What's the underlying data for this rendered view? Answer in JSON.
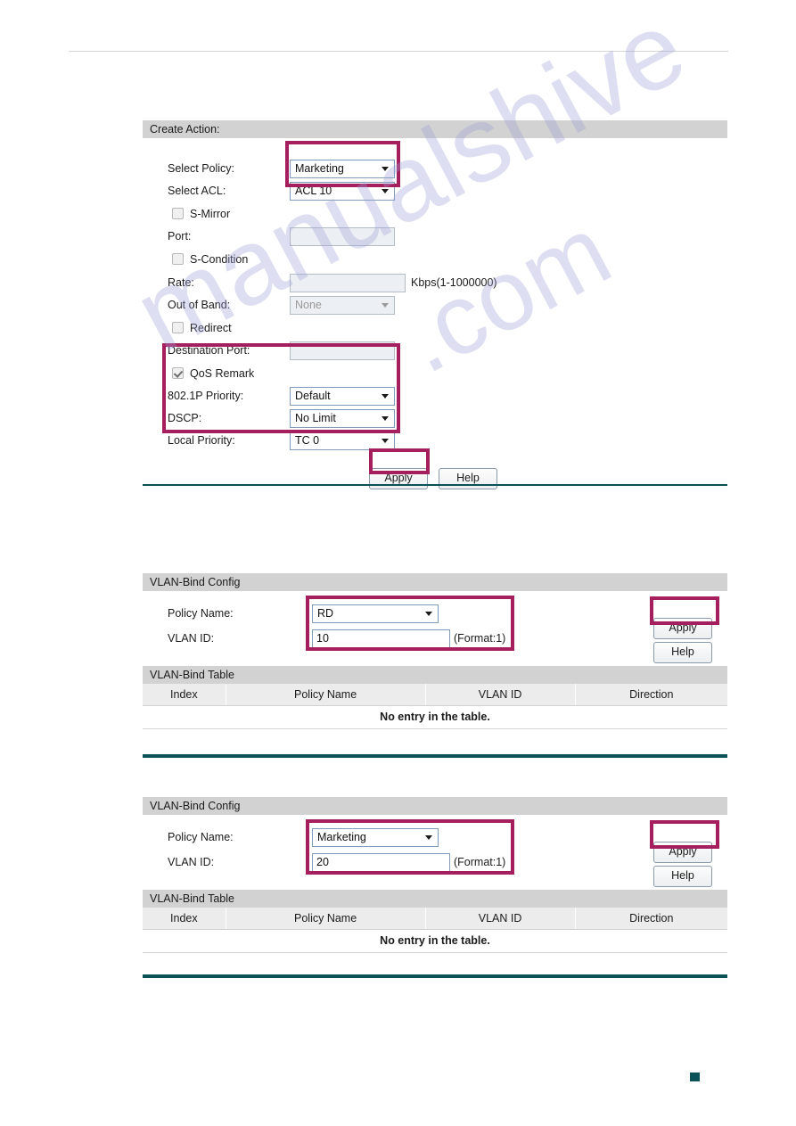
{
  "page": {
    "footer_marker": "teal-square",
    "accent_highlight": "#a51f5e",
    "rule_color": "#0b5158",
    "watermark_top": "manualshive",
    "watermark_bottom": ".com"
  },
  "create_action": {
    "title": "Create Action:",
    "fields": {
      "select_policy_label": "Select Policy:",
      "select_policy_value": "Marketing",
      "select_acl_label": "Select ACL:",
      "select_acl_value": "ACL 10",
      "s_mirror_label": "S-Mirror",
      "s_mirror_checked": false,
      "port_label": "Port:",
      "port_value": "",
      "s_condition_label": "S-Condition",
      "s_condition_checked": false,
      "rate_label": "Rate:",
      "rate_value": "",
      "rate_suffix": "Kbps(1-1000000)",
      "out_of_band_label": "Out of Band:",
      "out_of_band_value": "None",
      "redirect_label": "Redirect",
      "redirect_checked": false,
      "destination_port_label": "Destination Port:",
      "destination_port_value": "",
      "qos_remark_label": "QoS Remark",
      "qos_remark_checked": true,
      "priority_8021p_label": "802.1P Priority:",
      "priority_8021p_value": "Default",
      "dscp_label": "DSCP:",
      "dscp_value": "No Limit",
      "local_priority_label": "Local Priority:",
      "local_priority_value": "TC 0"
    },
    "buttons": {
      "apply": "Apply",
      "help": "Help"
    }
  },
  "vlan_bind_1": {
    "config_title": "VLAN-Bind Config",
    "policy_name_label": "Policy Name:",
    "policy_name_value": "RD",
    "vlan_id_label": "VLAN ID:",
    "vlan_id_value": "10",
    "vlan_id_format": "(Format:1)",
    "apply": "Apply",
    "help": "Help",
    "table_title": "VLAN-Bind Table",
    "table_headers": [
      "Index",
      "Policy Name",
      "VLAN ID",
      "Direction"
    ],
    "table_empty": "No entry in the table."
  },
  "vlan_bind_2": {
    "config_title": "VLAN-Bind Config",
    "policy_name_label": "Policy Name:",
    "policy_name_value": "Marketing",
    "vlan_id_label": "VLAN ID:",
    "vlan_id_value": "20",
    "vlan_id_format": "(Format:1)",
    "apply": "Apply",
    "help": "Help",
    "table_title": "VLAN-Bind Table",
    "table_headers": [
      "Index",
      "Policy Name",
      "VLAN ID",
      "Direction"
    ],
    "table_empty": "No entry in the table."
  }
}
